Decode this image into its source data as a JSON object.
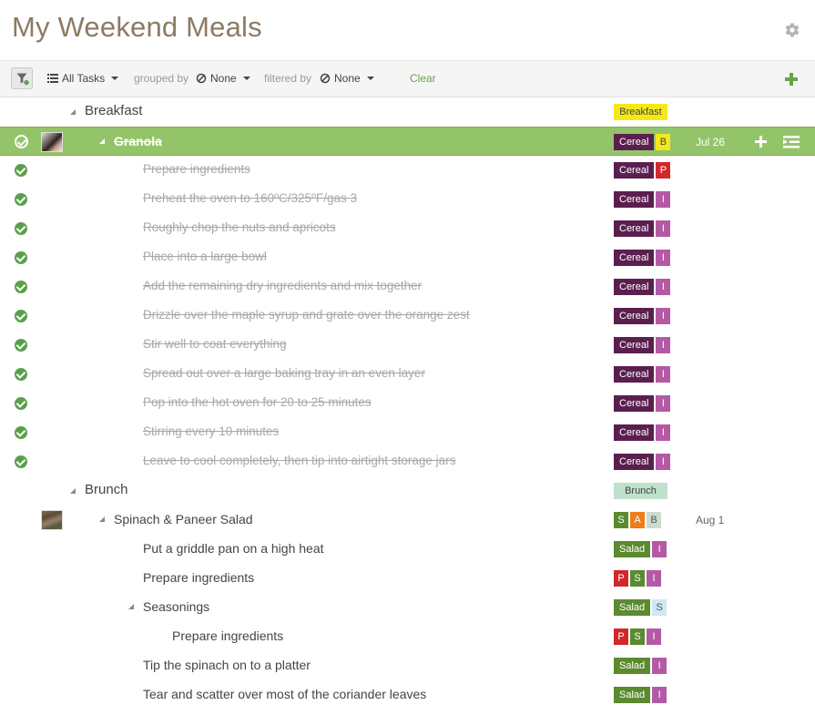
{
  "app": {
    "title": "My Weekend Meals",
    "settings_icon": "gear-icon"
  },
  "toolbar": {
    "view_label": "All Tasks",
    "grouped_by_label": "grouped by",
    "grouped_by_value": "None",
    "filtered_by_label": "filtered by",
    "filtered_by_value": "None",
    "clear_label": "Clear",
    "accent_color": "#6aa34a"
  },
  "tag_colors": {
    "Breakfast": "#f5e81a",
    "Cereal": "#5a1f4f",
    "B": "#f5e81a",
    "P": "#d0282d",
    "I": "#b45aa4",
    "Brunch": "#bfe0cb",
    "S": "#5b8a2f",
    "A": "#ee7d1a",
    "B2": "#c9dccf",
    "Salad": "#5b8a2f",
    "S_light": "#cde8f3"
  },
  "rows": [
    {
      "type": "group",
      "title": "Breakfast",
      "tags": [
        {
          "text": "Breakfast",
          "style": "wide",
          "color": "#f5e81a",
          "fg": "#444"
        }
      ]
    },
    {
      "type": "task",
      "selected": true,
      "completed": true,
      "avatar": "a1",
      "title": "Granola",
      "level": 1,
      "expandable": true,
      "date": "Jul 26",
      "tags": [
        {
          "text": "Cereal",
          "color": "#5a1f4f"
        },
        {
          "text": "B",
          "style": "short",
          "color": "#f5e81a",
          "fg": "#444"
        }
      ]
    },
    {
      "type": "task",
      "completed": true,
      "title": "Prepare ingredients",
      "level": 2,
      "tags": [
        {
          "text": "Cereal",
          "color": "#5a1f4f"
        },
        {
          "text": "P",
          "style": "short",
          "color": "#d0282d"
        }
      ]
    },
    {
      "type": "task",
      "completed": true,
      "title": "Preheat the oven to 160ºC/325ºF/gas 3",
      "level": 2,
      "tags": [
        {
          "text": "Cereal",
          "color": "#5a1f4f"
        },
        {
          "text": "I",
          "style": "short",
          "color": "#b45aa4"
        }
      ]
    },
    {
      "type": "task",
      "completed": true,
      "title": "Roughly chop the nuts and apricots",
      "level": 2,
      "tags": [
        {
          "text": "Cereal",
          "color": "#5a1f4f"
        },
        {
          "text": "I",
          "style": "short",
          "color": "#b45aa4"
        }
      ]
    },
    {
      "type": "task",
      "completed": true,
      "title": "Place into a large bowl",
      "level": 2,
      "tags": [
        {
          "text": "Cereal",
          "color": "#5a1f4f"
        },
        {
          "text": "I",
          "style": "short",
          "color": "#b45aa4"
        }
      ]
    },
    {
      "type": "task",
      "completed": true,
      "title": "Add the remaining dry ingredients and mix together",
      "level": 2,
      "tags": [
        {
          "text": "Cereal",
          "color": "#5a1f4f"
        },
        {
          "text": "I",
          "style": "short",
          "color": "#b45aa4"
        }
      ]
    },
    {
      "type": "task",
      "completed": true,
      "title": "Drizzle over the maple syrup and grate over the orange zest",
      "level": 2,
      "tags": [
        {
          "text": "Cereal",
          "color": "#5a1f4f"
        },
        {
          "text": "I",
          "style": "short",
          "color": "#b45aa4"
        }
      ]
    },
    {
      "type": "task",
      "completed": true,
      "title": "Stir well to coat everything",
      "level": 2,
      "tags": [
        {
          "text": "Cereal",
          "color": "#5a1f4f"
        },
        {
          "text": "I",
          "style": "short",
          "color": "#b45aa4"
        }
      ]
    },
    {
      "type": "task",
      "completed": true,
      "title": "Spread out over a large baking tray in an even layer",
      "level": 2,
      "tags": [
        {
          "text": "Cereal",
          "color": "#5a1f4f"
        },
        {
          "text": "I",
          "style": "short",
          "color": "#b45aa4"
        }
      ]
    },
    {
      "type": "task",
      "completed": true,
      "title": "Pop into the hot oven for 20 to 25 minutes",
      "level": 2,
      "tags": [
        {
          "text": "Cereal",
          "color": "#5a1f4f"
        },
        {
          "text": "I",
          "style": "short",
          "color": "#b45aa4"
        }
      ]
    },
    {
      "type": "task",
      "completed": true,
      "title": "Stirring every 10 minutes",
      "level": 2,
      "tags": [
        {
          "text": "Cereal",
          "color": "#5a1f4f"
        },
        {
          "text": "I",
          "style": "short",
          "color": "#b45aa4"
        }
      ]
    },
    {
      "type": "task",
      "completed": true,
      "title": "Leave to cool completely, then tip into airtight storage jars",
      "level": 2,
      "tags": [
        {
          "text": "Cereal",
          "color": "#5a1f4f"
        },
        {
          "text": "I",
          "style": "short",
          "color": "#b45aa4"
        }
      ]
    },
    {
      "type": "group",
      "title": "Brunch",
      "tags": [
        {
          "text": "Brunch",
          "style": "wide",
          "color": "#bfe0cb",
          "fg": "#444"
        }
      ]
    },
    {
      "type": "task",
      "avatar": "a2",
      "title": "Spinach & Paneer Salad",
      "level": 1,
      "expandable": true,
      "date": "Aug 1",
      "tags": [
        {
          "text": "S",
          "style": "short",
          "color": "#5b8a2f"
        },
        {
          "text": "A",
          "style": "short",
          "color": "#ee7d1a"
        },
        {
          "text": "B",
          "style": "short",
          "color": "#c9dccf",
          "fg": "#555"
        }
      ]
    },
    {
      "type": "task",
      "title": "Put a griddle pan on a high heat",
      "level": 2,
      "tags": [
        {
          "text": "Salad",
          "color": "#5b8a2f"
        },
        {
          "text": "I",
          "style": "short",
          "color": "#b45aa4"
        }
      ]
    },
    {
      "type": "task",
      "title": "Prepare ingredients",
      "level": 2,
      "tags": [
        {
          "text": "P",
          "style": "short",
          "color": "#d0282d"
        },
        {
          "text": "S",
          "style": "short",
          "color": "#5b8a2f"
        },
        {
          "text": "I",
          "style": "short",
          "color": "#b45aa4"
        }
      ]
    },
    {
      "type": "task",
      "title": "Seasonings",
      "level": 2,
      "expandable": true,
      "tags": [
        {
          "text": "Salad",
          "color": "#5b8a2f"
        },
        {
          "text": "S",
          "style": "short",
          "color": "#cde8f3",
          "fg": "#555"
        }
      ]
    },
    {
      "type": "task",
      "title": "Prepare ingredients",
      "level": 3,
      "tags": [
        {
          "text": "P",
          "style": "short",
          "color": "#d0282d"
        },
        {
          "text": "S",
          "style": "short",
          "color": "#5b8a2f"
        },
        {
          "text": "I",
          "style": "short",
          "color": "#b45aa4"
        }
      ]
    },
    {
      "type": "task",
      "title": "Tip the spinach on to a platter",
      "level": 2,
      "tags": [
        {
          "text": "Salad",
          "color": "#5b8a2f"
        },
        {
          "text": "I",
          "style": "short",
          "color": "#b45aa4"
        }
      ]
    },
    {
      "type": "task",
      "title": "Tear and scatter over most of the coriander leaves",
      "level": 2,
      "tags": [
        {
          "text": "Salad",
          "color": "#5b8a2f"
        },
        {
          "text": "I",
          "style": "short",
          "color": "#b45aa4"
        }
      ]
    }
  ]
}
